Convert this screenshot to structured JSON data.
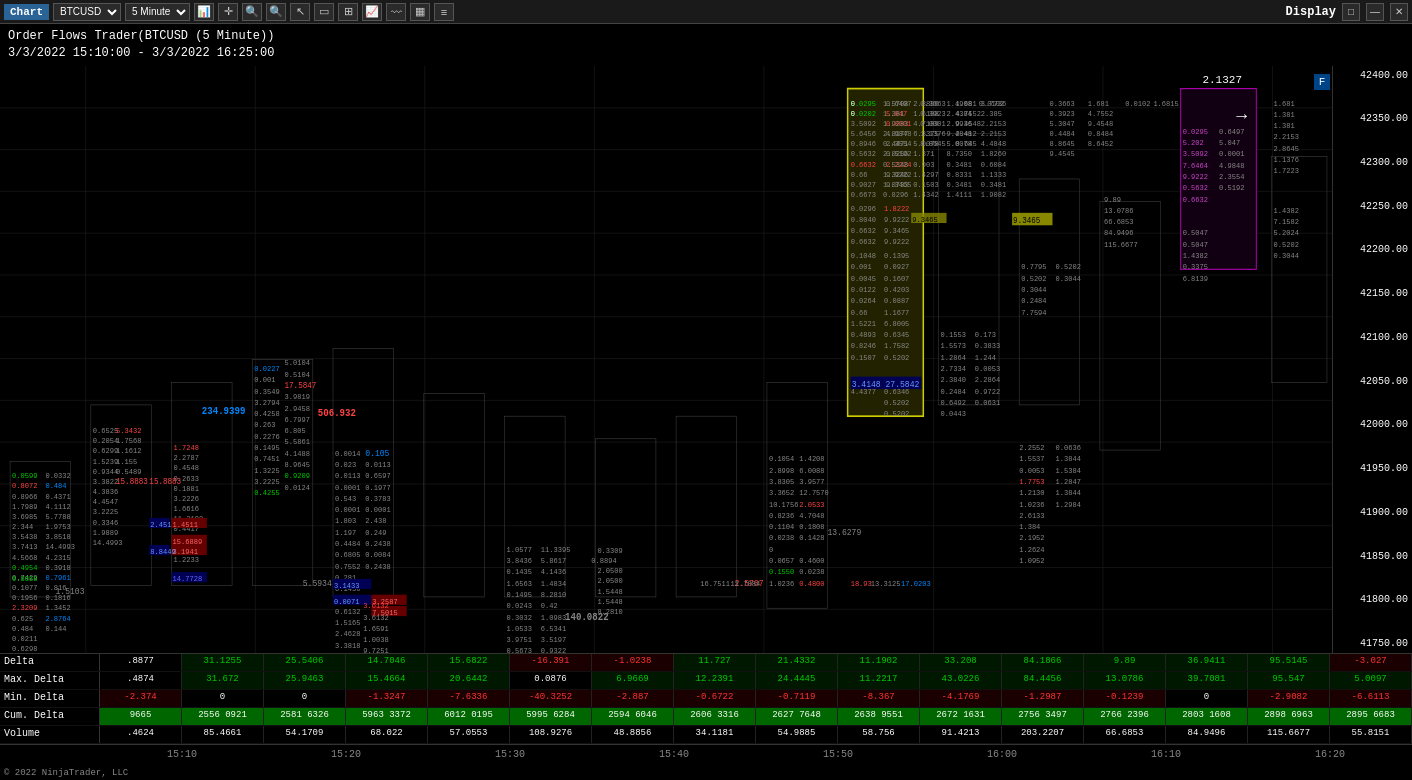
{
  "titlebar": {
    "chart_label": "Chart",
    "symbol": "BTCUSD",
    "timeframe": "5 Minute",
    "display": "Display",
    "window_buttons": [
      "□",
      "—",
      "✕"
    ]
  },
  "header": {
    "title": "Order Flows Trader(BTCUSD (5 Minute))",
    "date_range": "3/3/2022 15:10:00 - 3/3/2022 16:25:00"
  },
  "price_axis": {
    "levels": [
      "42400.00",
      "42350.00",
      "42300.00",
      "42250.00",
      "42200.00",
      "42150.00",
      "42100.00",
      "42050.00",
      "42000.00",
      "41950.00",
      "41900.00",
      "41850.00",
      "41800.00",
      "41750.00"
    ]
  },
  "info_box": {
    "value1": "2.1327"
  },
  "stats": {
    "rows": [
      {
        "label": "Delta",
        "cells": [
          ".8877",
          "31.1255",
          "25.5406",
          "14.7046",
          "15.6822",
          "-16.391",
          "-1.0238",
          "11.727",
          "21.4332",
          "11.1902",
          "33.208",
          "84.1866",
          "9.89",
          "36.9411",
          "95.5145",
          "-3.027"
        ],
        "types": [
          "neutral",
          "positive",
          "positive",
          "positive",
          "positive",
          "negative",
          "negative",
          "positive",
          "positive",
          "positive",
          "positive",
          "positive",
          "positive",
          "positive",
          "positive",
          "negative"
        ]
      },
      {
        "label": "Max. Delta",
        "cells": [
          ".4874",
          "31.672",
          "25.9463",
          "15.4664",
          "20.6442",
          "0.0876",
          "6.9669",
          "12.2391",
          "24.4445",
          "11.2217",
          "43.0226",
          "84.4456",
          "13.0786",
          "39.7081",
          "95.547",
          "5.0097"
        ],
        "types": [
          "neutral",
          "positive",
          "positive",
          "positive",
          "positive",
          "neutral",
          "positive",
          "positive",
          "positive",
          "positive",
          "positive",
          "positive",
          "positive",
          "positive",
          "positive",
          "positive"
        ]
      },
      {
        "label": "Min. Delta",
        "cells": [
          "-2.374",
          "0",
          "0",
          "-1.3247",
          "-7.6336",
          "-40.3252",
          "-2.887",
          "-0.6722",
          "-0.7119",
          "-8.367",
          "-4.1769",
          "-1.2987",
          "-0.1239",
          "0",
          "-2.9082",
          "-6.6113"
        ],
        "types": [
          "negative",
          "neutral",
          "neutral",
          "negative",
          "negative",
          "negative",
          "negative",
          "negative",
          "negative",
          "negative",
          "negative",
          "negative",
          "negative",
          "neutral",
          "negative",
          "negative"
        ]
      },
      {
        "label": "Cum. Delta",
        "cells": [
          "9665",
          "2556",
          "0921",
          "2581",
          "6326",
          "5963",
          "3372",
          "6012",
          "0195",
          "5995",
          "6284",
          "2594",
          "6046",
          "2606",
          "3316",
          "2627",
          "7648",
          "2638",
          "9551",
          "2672",
          "1631",
          "2756",
          "3497",
          "2766",
          "2396",
          "2803",
          "1608",
          "2898",
          "6963",
          "2895",
          "6683"
        ],
        "types": [
          "green-bg",
          "green-bg",
          "green-bg",
          "green-bg",
          "green-bg",
          "green-bg",
          "green-bg",
          "green-bg",
          "green-bg",
          "green-bg",
          "green-bg",
          "green-bg",
          "green-bg",
          "green-bg",
          "green-bg",
          "green-bg"
        ]
      },
      {
        "label": "Volume",
        "cells": [
          ".4624",
          "85.4661",
          "54.1709",
          "68.022",
          "57.0553",
          "108.9276",
          "48.8856",
          "34.1181",
          "54.9885",
          "58.756",
          "91.4213",
          "203.2207",
          "66.6853",
          "84.9496",
          "115.6677",
          "55.8151"
        ],
        "types": [
          "neutral",
          "neutral",
          "neutral",
          "neutral",
          "neutral",
          "neutral",
          "neutral",
          "neutral",
          "neutral",
          "neutral",
          "neutral",
          "neutral",
          "neutral",
          "neutral",
          "neutral",
          "neutral"
        ]
      }
    ]
  },
  "time_axis": {
    "labels": [
      "15:10",
      "15:20",
      "15:30",
      "15:40",
      "15:50",
      "16:00",
      "16:10",
      "16:20"
    ]
  },
  "copyright": "© 2022 NinjaTrader, LLC"
}
